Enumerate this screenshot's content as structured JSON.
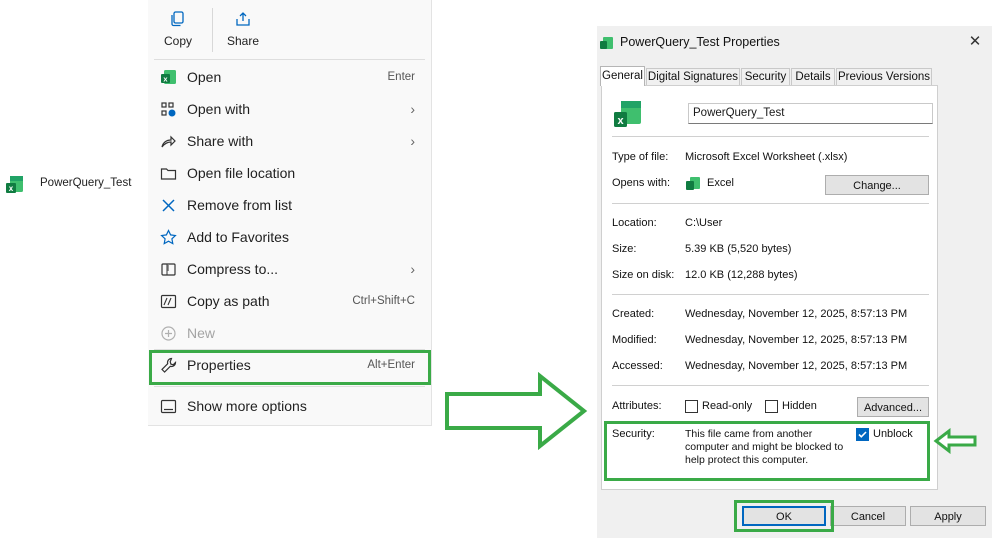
{
  "desktop": {
    "file_name": "PowerQuery_Test"
  },
  "context_menu": {
    "quick_actions": [
      {
        "label": "Copy",
        "icon": "copy-icon"
      },
      {
        "label": "Share",
        "icon": "share-icon"
      }
    ],
    "items": [
      {
        "label": "Open",
        "shortcut": "Enter",
        "icon": "excel-icon"
      },
      {
        "label": "Open with",
        "shortcut": "",
        "icon": "open-with-icon",
        "chevron": "›"
      },
      {
        "label": "Share with",
        "shortcut": "",
        "icon": "share-with-icon",
        "chevron": "›"
      },
      {
        "label": "Open file location",
        "shortcut": "",
        "icon": "folder-icon"
      },
      {
        "label": "Remove from list",
        "shortcut": "",
        "icon": "x-icon"
      },
      {
        "label": "Add to Favorites",
        "shortcut": "",
        "icon": "star-icon"
      },
      {
        "label": "Compress to...",
        "shortcut": "",
        "icon": "zip-icon",
        "chevron": "›"
      },
      {
        "label": "Copy as path",
        "shortcut": "Ctrl+Shift+C",
        "icon": "copy-path-icon"
      },
      {
        "label": "New",
        "shortcut": "",
        "icon": "plus-circle-icon",
        "disabled": true
      },
      {
        "label": "Properties",
        "shortcut": "Alt+Enter",
        "icon": "wrench-icon"
      },
      {
        "label": "Show more options",
        "shortcut": "",
        "icon": "more-options-icon"
      }
    ]
  },
  "dialog": {
    "title": "PowerQuery_Test Properties",
    "close": "✕",
    "tabs": [
      "General",
      "Digital Signatures",
      "Security",
      "Details",
      "Previous Versions"
    ],
    "file_name": "PowerQuery_Test",
    "type_label": "Type of file:",
    "type_value": "Microsoft Excel Worksheet (.xlsx)",
    "opens_label": "Opens with:",
    "opens_value": "Excel",
    "change_button": "Change...",
    "location_label": "Location:",
    "location_value": "C:\\User",
    "size_label": "Size:",
    "size_value": "5.39 KB (5,520 bytes)",
    "size_disk_label": "Size on disk:",
    "size_disk_value": "12.0 KB (12,288 bytes)",
    "created_label": "Created:",
    "created_value": "Wednesday, November 12, 2025, 8:57:13 PM",
    "modified_label": "Modified:",
    "modified_value": "Wednesday, November 12, 2025, 8:57:13 PM",
    "accessed_label": "Accessed:",
    "accessed_value": "Wednesday, November 12, 2025, 8:57:13 PM",
    "attributes_label": "Attributes:",
    "readonly_label": "Read-only",
    "readonly_checked": false,
    "hidden_label": "Hidden",
    "hidden_checked": false,
    "advanced_button": "Advanced...",
    "security_label": "Security:",
    "security_line1": "This file came from another",
    "security_line2": "computer and might be blocked to",
    "security_line3": "help protect this computer.",
    "unblock_label": "Unblock",
    "unblock_checked": true,
    "ok_button": "OK",
    "cancel_button": "Cancel",
    "apply_button": "Apply"
  },
  "colors": {
    "highlight": "#3aaa47",
    "excel_green": "#1d7044",
    "accent_blue": "#0067c0"
  }
}
